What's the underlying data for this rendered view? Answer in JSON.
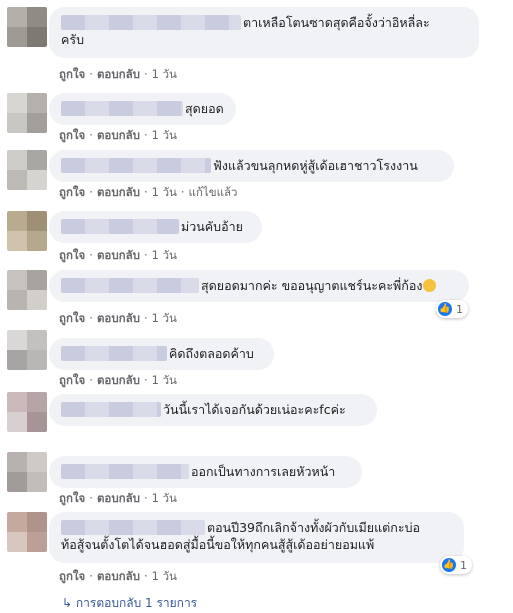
{
  "labels": {
    "like": "ถูกใจ",
    "dot": "·",
    "reply": "ตอบกลับ",
    "edited": "แก้ไขแล้ว"
  },
  "comments": [
    {
      "text": "ตาเหลือโตนซาดสุดคือจั้งว่าอิหลี่ละครับ",
      "line1": "ตาเหลือโตนซาดสุดคือจั้งว่าอิหลี่ละ",
      "line2": "ครับ",
      "time": "1 วัน"
    },
    {
      "text": "สุดยอด",
      "time": "1 วัน"
    },
    {
      "text": "ฟังแล้วขนลุกหดหู่สู้เด้อเฮาชาวโรงงาน",
      "time": "1 วัน",
      "edited": true
    },
    {
      "text": "ม่วนคับอ้าย",
      "time": "1 วัน"
    },
    {
      "text": "สุดยอดมากค่ะ ขออนุญาตแชร์นะคะพี่ก้อง",
      "emoji": "clapping-hands-emoji",
      "time": "1 วัน",
      "reactions": {
        "icon": "like-icon",
        "count": "1"
      }
    },
    {
      "text": "คิดถึงตลอดค้าบ",
      "time": "1 วัน"
    },
    {
      "text": "วันนี้เราได้เจอกันด้วยเน่อะคะfcค่ะ",
      "time": "1 วัน"
    },
    {
      "text": "ออกเป็นทางการเลยหัวหน้า",
      "time": "1 วัน"
    },
    {
      "text": "ตอนปี39ถึกเลิกจ้างทั้งผัวกับเมียแต่กะบ่อท้อสู้จนตั้งโตได้จนฮอดสู่มื้อนี้ขอให้ทุกคนสู้สู้เด้ออย่ายอมแพ้",
      "line1": "ตอนปี39ถึกเลิกจ้างทั้งผัวกับเมียแต่กะบ่อ",
      "line2": "ท้อสู้จนตั้งโตได้จนฮอดสู่มื้อนี้ขอให้ทุกคนสู้สู้เด้ออย่ายอมแพ้",
      "time": "1 วัน",
      "reactions": {
        "icon": "like-icon",
        "count": "1"
      }
    }
  ],
  "more_replies": {
    "arrow": "↳",
    "text": "การตอบกลับ 1 รายการ"
  },
  "colors": {
    "bubble": "#f0f2f5",
    "link": "#385898",
    "meta": "#65676b",
    "like_blue": "#1877f2"
  }
}
